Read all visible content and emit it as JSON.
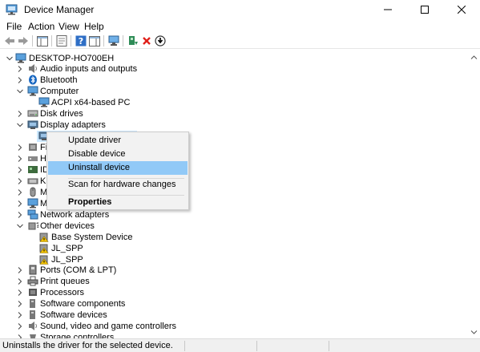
{
  "window": {
    "title": "Device Manager"
  },
  "menu": [
    "File",
    "Action",
    "View",
    "Help"
  ],
  "tree": {
    "root": "DESKTOP-HO700EH",
    "nodes": [
      {
        "label": "Audio inputs and outputs",
        "icon": "speaker-icon"
      },
      {
        "label": "Bluetooth",
        "icon": "bluetooth-icon"
      },
      {
        "label": "Computer",
        "icon": "computer-icon"
      },
      {
        "label": "ACPI x64-based PC",
        "icon": "monitor-icon"
      },
      {
        "label": "Disk drives",
        "icon": "disk-drive-icon"
      },
      {
        "label": "Display adapters",
        "icon": "display-adapter-icon"
      },
      {
        "label": "",
        "icon": "display-adapter-icon"
      },
      {
        "label": "Fi",
        "icon": "firmware-icon"
      },
      {
        "label": "H",
        "icon": "hid-icon"
      },
      {
        "label": "ID",
        "icon": "ide-icon"
      },
      {
        "label": "K",
        "icon": "keyboard-icon"
      },
      {
        "label": "M",
        "icon": "mouse-icon"
      },
      {
        "label": "M",
        "icon": "monitor-icon"
      },
      {
        "label": "Network adapters",
        "icon": "network-adapter-icon"
      },
      {
        "label": "Other devices",
        "icon": "other-devices-icon"
      },
      {
        "label": "Base System Device",
        "icon": "warning-device-icon"
      },
      {
        "label": "JL_SPP",
        "icon": "warning-device-icon"
      },
      {
        "label": "JL_SPP",
        "icon": "warning-device-icon"
      },
      {
        "label": "Ports (COM & LPT)",
        "icon": "port-icon"
      },
      {
        "label": "Print queues",
        "icon": "printer-icon"
      },
      {
        "label": "Processors",
        "icon": "processor-icon"
      },
      {
        "label": "Software components",
        "icon": "software-component-icon"
      },
      {
        "label": "Software devices",
        "icon": "software-device-icon"
      },
      {
        "label": "Sound, video and game controllers",
        "icon": "sound-icon"
      },
      {
        "label": "Storage controllers",
        "icon": "storage-icon"
      }
    ]
  },
  "context_menu": {
    "items": [
      "Update driver",
      "Disable device",
      "Uninstall device",
      "Scan for hardware changes",
      "Properties"
    ],
    "highlighted": "Uninstall device"
  },
  "status": {
    "text": "Uninstalls the driver for the selected device."
  },
  "colors": {
    "highlight": "#91c9f7",
    "selected_node": "#cce8ff",
    "menu_bg": "#f2f2f2"
  }
}
